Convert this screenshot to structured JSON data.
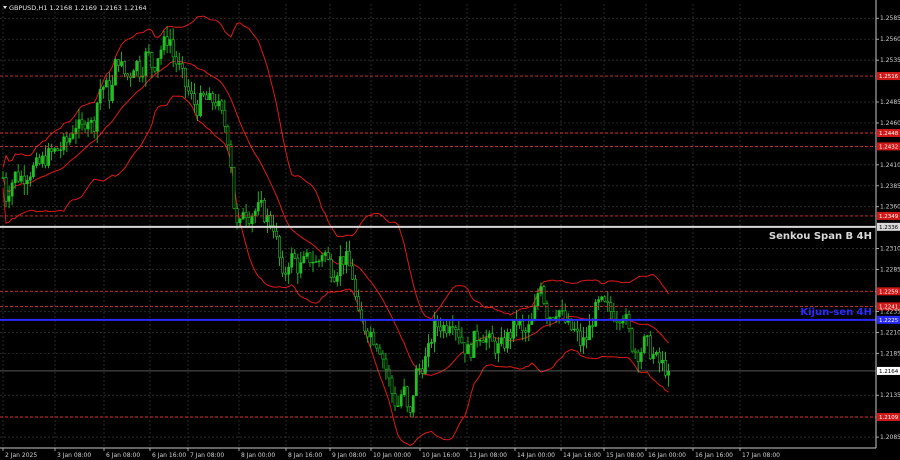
{
  "header": {
    "symbol_info": "GBPUSD,H1  1.2168 1.2169 1.2163 1.2164"
  },
  "chart_data": {
    "type": "candlestick",
    "symbol": "GBPUSD",
    "timeframe": "H1",
    "ohlc_label": "1.2168 1.2169 1.2163 1.2164",
    "ylim": [
      1.2072,
      1.2602
    ],
    "x_ticks": [
      "2 Jan 2025",
      "3 Jan 08:00",
      "6 Jan 08:00",
      "6 Jan 16:00",
      "7 Jan 08:00",
      "8 Jan 00:00",
      "8 Jan 16:00",
      "9 Jan 08:00",
      "10 Jan 00:00",
      "10 Jan 16:00",
      "13 Jan 08:00",
      "14 Jan 00:00",
      "14 Jan 16:00",
      "15 Jan 08:00",
      "16 Jan 00:00",
      "16 Jan 16:00",
      "17 Jan 08:00"
    ],
    "y_ticks": [
      "1.2585",
      "1.2560",
      "1.2535",
      "1.2485",
      "1.2460",
      "1.2410",
      "1.2385",
      "1.2360",
      "1.2310",
      "1.2285",
      "1.2235",
      "1.2210",
      "1.2185",
      "1.2135",
      "1.2085"
    ],
    "levels": [
      {
        "value": 1.2516,
        "label": "1.2516",
        "color": "#e03030"
      },
      {
        "value": 1.2448,
        "label": "1.2448",
        "color": "#e03030"
      },
      {
        "value": 1.2432,
        "label": "1.2432",
        "color": "#e03030"
      },
      {
        "value": 1.2349,
        "label": "1.2349",
        "color": "#e03030"
      },
      {
        "value": 1.2259,
        "label": "1.2259",
        "color": "#e03030"
      },
      {
        "value": 1.2241,
        "label": "1.2241",
        "color": "#e03030"
      },
      {
        "value": 1.2109,
        "label": "1.2109",
        "color": "#e03030"
      }
    ],
    "senkou_span_b_4h": {
      "value": 1.2336,
      "label": "1.2336",
      "text": "Senkou Span B 4H",
      "color": "#d8d8d8"
    },
    "kijun_sen_4h": {
      "value": 1.2225,
      "label": "1.2225",
      "text": "Kijun-sen 4H",
      "color": "#2a2aff"
    },
    "current_price": {
      "value": 1.2164,
      "label": "1.2164"
    },
    "price_path": [
      [
        0,
        1.2395
      ],
      [
        3,
        1.2372
      ],
      [
        7,
        1.2385
      ],
      [
        12,
        1.2398
      ],
      [
        18,
        1.2395
      ],
      [
        22,
        1.2398
      ],
      [
        30,
        1.2405
      ],
      [
        36,
        1.241
      ],
      [
        42,
        1.2418
      ],
      [
        50,
        1.2425
      ],
      [
        58,
        1.243
      ],
      [
        66,
        1.244
      ],
      [
        72,
        1.246
      ],
      [
        78,
        1.245
      ],
      [
        84,
        1.247
      ],
      [
        90,
        1.2452
      ],
      [
        96,
        1.25
      ],
      [
        102,
        1.2505
      ],
      [
        108,
        1.249
      ],
      [
        114,
        1.2543
      ],
      [
        120,
        1.252
      ],
      [
        126,
        1.2515
      ],
      [
        132,
        1.2535
      ],
      [
        138,
        1.252
      ],
      [
        144,
        1.2545
      ],
      [
        150,
        1.2525
      ],
      [
        156,
        1.2545
      ],
      [
        162,
        1.2556
      ],
      [
        166,
        1.2566
      ],
      [
        170,
        1.254
      ],
      [
        176,
        1.2525
      ],
      [
        182,
        1.2505
      ],
      [
        188,
        1.249
      ],
      [
        194,
        1.2478
      ],
      [
        200,
        1.249
      ],
      [
        206,
        1.2485
      ],
      [
        212,
        1.2488
      ],
      [
        218,
        1.247
      ],
      [
        224,
        1.245
      ],
      [
        228,
        1.241
      ],
      [
        232,
        1.234
      ],
      [
        236,
        1.233
      ],
      [
        240,
        1.236
      ],
      [
        246,
        1.235
      ],
      [
        252,
        1.2355
      ],
      [
        258,
        1.2358
      ],
      [
        264,
        1.2345
      ],
      [
        270,
        1.234
      ],
      [
        276,
        1.23
      ],
      [
        280,
        1.2265
      ],
      [
        284,
        1.2295
      ],
      [
        290,
        1.23
      ],
      [
        296,
        1.2285
      ],
      [
        302,
        1.2295
      ],
      [
        308,
        1.23
      ],
      [
        314,
        1.229
      ],
      [
        320,
        1.231
      ],
      [
        326,
        1.229
      ],
      [
        332,
        1.228
      ],
      [
        338,
        1.23
      ],
      [
        344,
        1.2295
      ],
      [
        350,
        1.2275
      ],
      [
        354,
        1.223
      ],
      [
        358,
        1.222
      ],
      [
        364,
        1.2215
      ],
      [
        370,
        1.2205
      ],
      [
        376,
        1.2195
      ],
      [
        382,
        1.217
      ],
      [
        388,
        1.214
      ],
      [
        394,
        1.212
      ],
      [
        400,
        1.2145
      ],
      [
        406,
        1.21
      ],
      [
        412,
        1.216
      ],
      [
        418,
        1.217
      ],
      [
        424,
        1.218
      ],
      [
        430,
        1.2215
      ],
      [
        436,
        1.222
      ],
      [
        442,
        1.2215
      ],
      [
        448,
        1.223
      ],
      [
        454,
        1.2215
      ],
      [
        460,
        1.2195
      ],
      [
        466,
        1.2185
      ],
      [
        472,
        1.2205
      ],
      [
        478,
        1.221
      ],
      [
        484,
        1.22
      ],
      [
        490,
        1.2195
      ],
      [
        496,
        1.219
      ],
      [
        502,
        1.22
      ],
      [
        508,
        1.221
      ],
      [
        514,
        1.2225
      ],
      [
        520,
        1.2205
      ],
      [
        526,
        1.2215
      ],
      [
        530,
        1.2225
      ],
      [
        534,
        1.2255
      ],
      [
        538,
        1.2275
      ],
      [
        542,
        1.2235
      ],
      [
        548,
        1.223
      ],
      [
        554,
        1.224
      ],
      [
        560,
        1.2225
      ],
      [
        566,
        1.2215
      ],
      [
        572,
        1.221
      ],
      [
        578,
        1.2195
      ],
      [
        584,
        1.2205
      ],
      [
        590,
        1.223
      ],
      [
        596,
        1.2245
      ],
      [
        602,
        1.224
      ],
      [
        608,
        1.2235
      ],
      [
        614,
        1.223
      ],
      [
        620,
        1.2235
      ],
      [
        624,
        1.2215
      ],
      [
        630,
        1.219
      ],
      [
        636,
        1.2185
      ],
      [
        642,
        1.22
      ],
      [
        648,
        1.2185
      ],
      [
        654,
        1.2175
      ],
      [
        660,
        1.217
      ],
      [
        665,
        1.2164
      ]
    ]
  }
}
